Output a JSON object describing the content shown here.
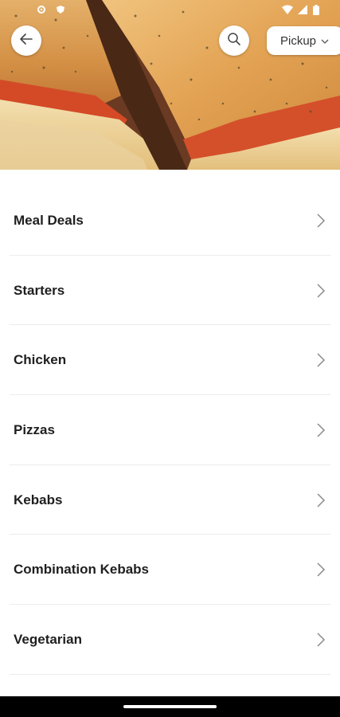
{
  "header": {
    "back_icon": "arrow-left-icon",
    "search_icon": "search-icon",
    "order_mode": "Pickup"
  },
  "menu": {
    "categories": [
      {
        "label": "Meal Deals"
      },
      {
        "label": "Starters"
      },
      {
        "label": "Chicken"
      },
      {
        "label": "Pizzas"
      },
      {
        "label": "Kebabs"
      },
      {
        "label": "Combination Kebabs"
      },
      {
        "label": "Vegetarian"
      }
    ]
  },
  "colors": {
    "text": "#1f1f1f",
    "divider": "#ececec",
    "nav_bar": "#000000"
  }
}
